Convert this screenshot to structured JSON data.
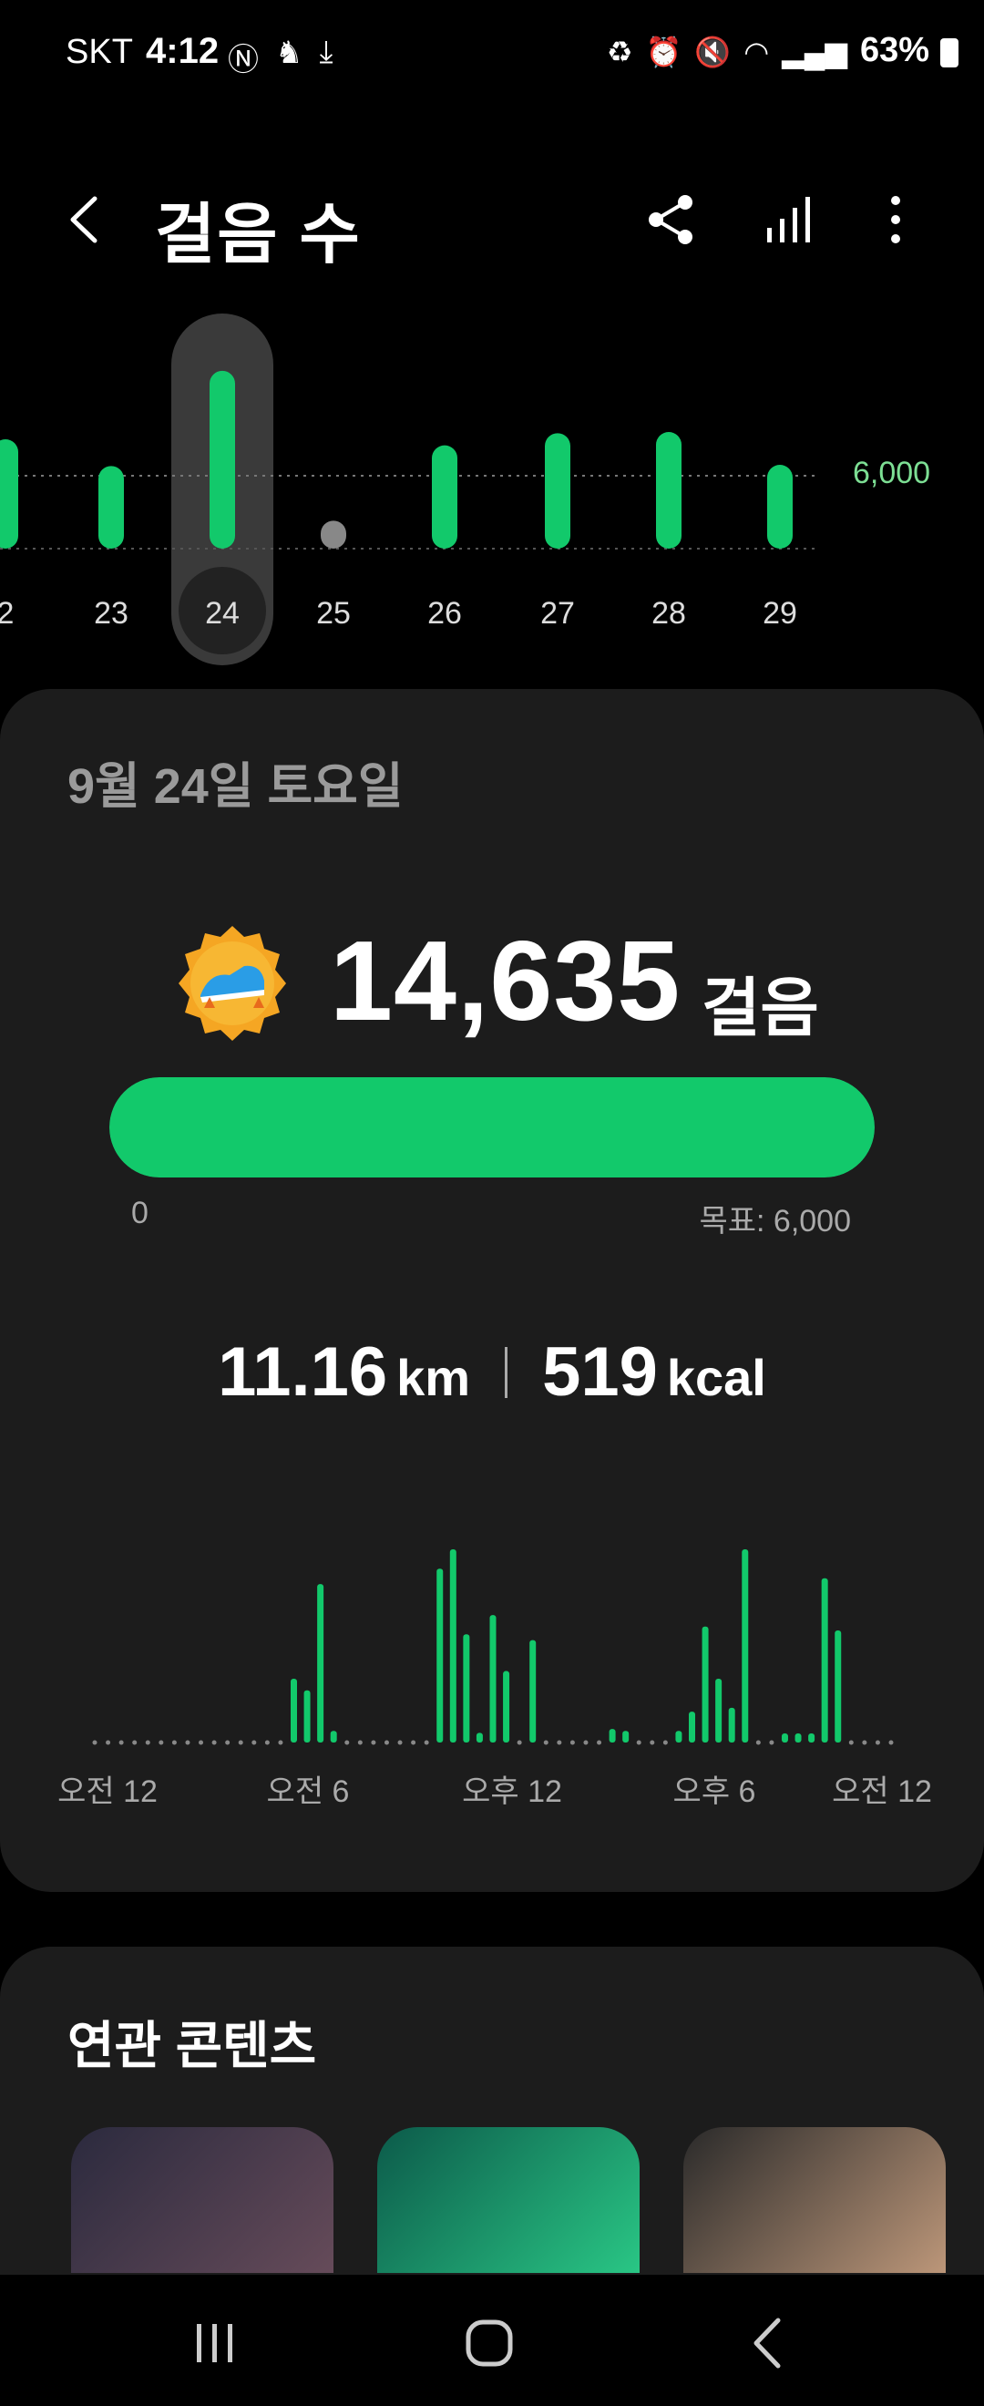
{
  "status_bar": {
    "carrier": "SKT",
    "time": "4:12",
    "battery": "63%",
    "left_icons": [
      "nfc-icon",
      "game-icon",
      "download-icon"
    ],
    "right_icons": [
      "recycle-icon",
      "alarm-icon",
      "mute-icon",
      "wifi-icon",
      "signal-icon"
    ]
  },
  "header": {
    "title": "걸음 수",
    "back_icon": "back-icon",
    "share_icon": "share-icon",
    "stats_icon": "bar-chart-icon",
    "more_icon": "more-vertical-icon"
  },
  "day_chart": {
    "goal_label": "6,000",
    "selected_day": "24",
    "days": [
      {
        "label": "2",
        "steps": 9000
      },
      {
        "label": "23",
        "steps": 6800
      },
      {
        "label": "24",
        "steps": 14635
      },
      {
        "label": "25",
        "steps": 2300
      },
      {
        "label": "26",
        "steps": 8500
      },
      {
        "label": "27",
        "steps": 9500
      },
      {
        "label": "28",
        "steps": 9600
      },
      {
        "label": "29",
        "steps": 6900
      }
    ]
  },
  "summary": {
    "date": "9월 24일 토요일",
    "steps": "14,635",
    "steps_unit": "걸음",
    "progress_fraction": 1.0,
    "progress_min": "0",
    "progress_goal": "목표: 6,000",
    "distance_value": "11.16",
    "distance_unit": "km",
    "calories_value": "519",
    "calories_unit": "kcal",
    "badge_icon": "shoe-medal-icon"
  },
  "hour_chart": {
    "x_labels": [
      "오전 12",
      "오전 6",
      "오후 12",
      "오후 6",
      "오전 12"
    ],
    "values": [
      0,
      0,
      0,
      0,
      0,
      0,
      0,
      0,
      0,
      0,
      0,
      0,
      0,
      0,
      0,
      0.33,
      0.27,
      0.82,
      0.06,
      0,
      0,
      0,
      0,
      0,
      0,
      0,
      0.9,
      1.0,
      0.56,
      0.05,
      0.66,
      0.37,
      0,
      0.53,
      0,
      0,
      0,
      0,
      0,
      0.07,
      0.06,
      0,
      0,
      0,
      0.06,
      0.16,
      0.6,
      0.33,
      0.18,
      1.0,
      0,
      0,
      0.04,
      0.04,
      0.04,
      0.85,
      0.58,
      0,
      0,
      0,
      0
    ]
  },
  "related": {
    "title": "연관 콘텐츠",
    "thumbs": [
      {
        "name": "milky-way-thumb",
        "c1": "#2b2a3e",
        "c2": "#6b4e5c"
      },
      {
        "name": "green-swirl-thumb",
        "c1": "#0c5a4a",
        "c2": "#2cd08a"
      },
      {
        "name": "fitness-man-thumb",
        "c1": "#2a2a2a",
        "c2": "#c9a080"
      }
    ]
  },
  "colors": {
    "accent": "#12c96b",
    "bar_inactive": "#888888"
  }
}
